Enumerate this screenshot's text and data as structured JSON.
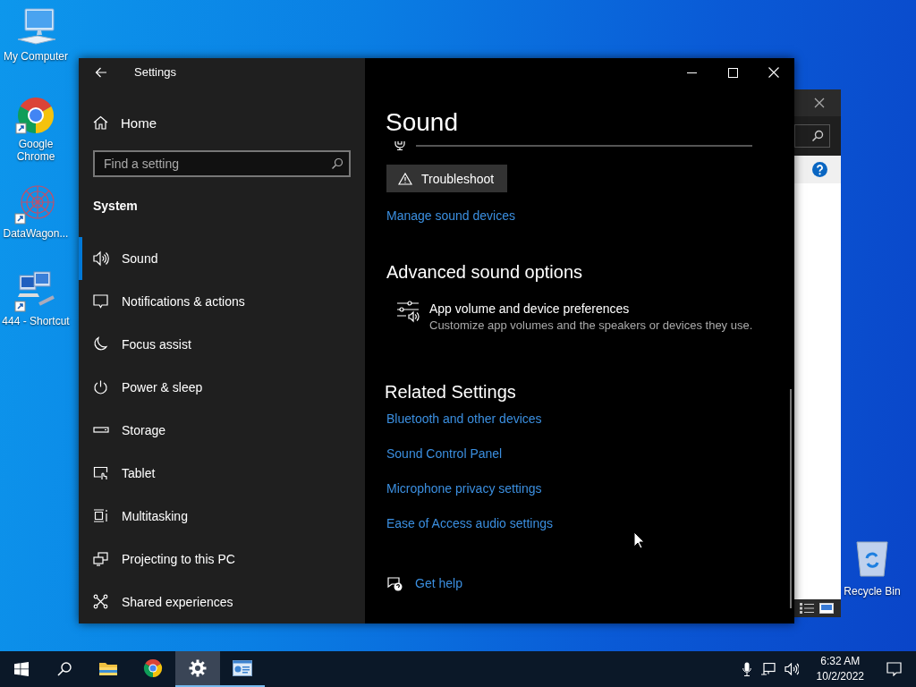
{
  "desktop_icons": [
    {
      "kind": "computer",
      "label": "My Computer"
    },
    {
      "kind": "chrome",
      "label": "Google Chrome"
    },
    {
      "kind": "datawagon",
      "label": "DataWagon..."
    },
    {
      "kind": "network",
      "label": "444 - Shortcut"
    }
  ],
  "recycle_bin": {
    "label": "Recycle Bin"
  },
  "settings_window": {
    "title": "Settings",
    "sidebar": {
      "home": "Home",
      "search": {
        "placeholder": "Find a setting"
      },
      "section": "System",
      "items": [
        {
          "kind": "sound",
          "label": "Sound",
          "selected": true
        },
        {
          "kind": "notifications",
          "label": "Notifications & actions",
          "selected": false
        },
        {
          "kind": "focus",
          "label": "Focus assist",
          "selected": false
        },
        {
          "kind": "power",
          "label": "Power & sleep",
          "selected": false
        },
        {
          "kind": "storage",
          "label": "Storage",
          "selected": false
        },
        {
          "kind": "tablet",
          "label": "Tablet",
          "selected": false
        },
        {
          "kind": "multitasking",
          "label": "Multitasking",
          "selected": false
        },
        {
          "kind": "projecting",
          "label": "Projecting to this PC",
          "selected": false
        },
        {
          "kind": "shared",
          "label": "Shared experiences",
          "selected": false
        }
      ]
    },
    "content": {
      "title": "Sound",
      "troubleshoot_button": "Troubleshoot",
      "manage_link": "Manage sound devices",
      "advanced_heading": "Advanced sound options",
      "app_volume": {
        "title": "App volume and device preferences",
        "description": "Customize app volumes and the speakers or devices they use."
      },
      "related_heading": "Related Settings",
      "related_links": [
        "Bluetooth and other devices",
        "Sound Control Panel",
        "Microphone privacy settings",
        "Ease of Access audio settings"
      ],
      "help_link": "Get help"
    }
  },
  "taskbar": {
    "apps": [
      {
        "kind": "explorer",
        "selected": false,
        "running": false
      },
      {
        "kind": "chrome",
        "selected": false,
        "running": false
      },
      {
        "kind": "settings",
        "selected": true,
        "running": true
      },
      {
        "kind": "controlpanel",
        "selected": false,
        "running": true
      }
    ],
    "time": "6:32 AM",
    "date": "10/2/2022"
  }
}
